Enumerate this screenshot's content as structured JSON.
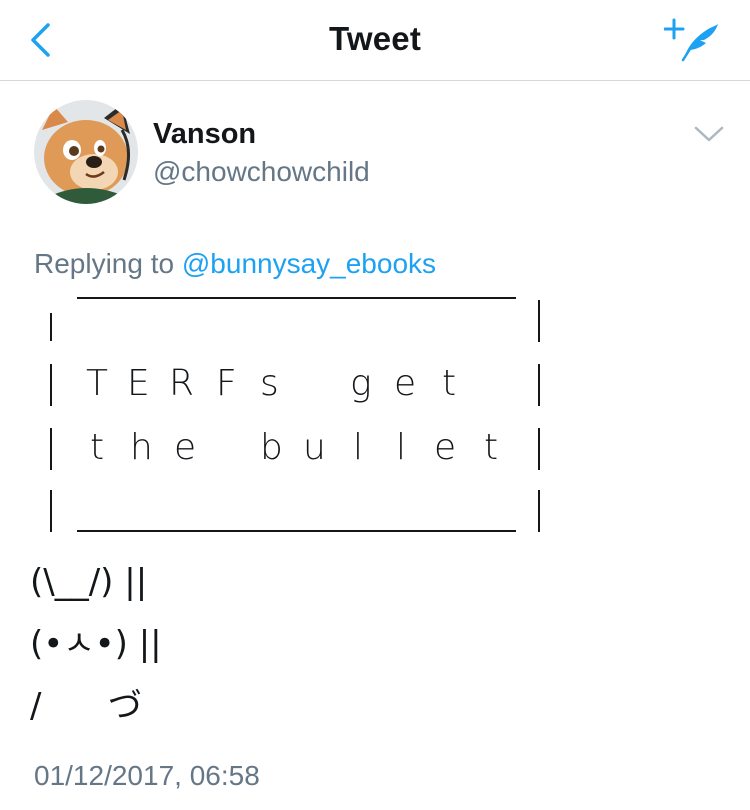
{
  "header": {
    "title": "Tweet",
    "back_icon": "chevron-left-icon",
    "compose_icon": "compose-tweet-icon",
    "accent": "#1da1f2"
  },
  "author": {
    "name": "Vanson",
    "handle": "@chowchowchild",
    "avatar_icon": "avatar-chow-dog"
  },
  "reply": {
    "prefix": "Replying to ",
    "to": "@bunnysay_ebooks"
  },
  "tweet": {
    "sign_line1_letters": [
      "T",
      "E",
      "R",
      "F",
      "s",
      "g",
      "e",
      "t"
    ],
    "sign_line2_letters": [
      "t",
      "h",
      "e",
      "b",
      "u",
      "l",
      "l",
      "e",
      "t"
    ],
    "bunny_line1": "(\\__/) ||",
    "bunny_line2": "(•ㅅ•) ||",
    "bunny_line3": "/  　 づ"
  },
  "timestamp": "01/12/2017, 06:58",
  "colors": {
    "text": "#14171a",
    "secondary": "#657786",
    "divider": "#d6d9dc"
  }
}
